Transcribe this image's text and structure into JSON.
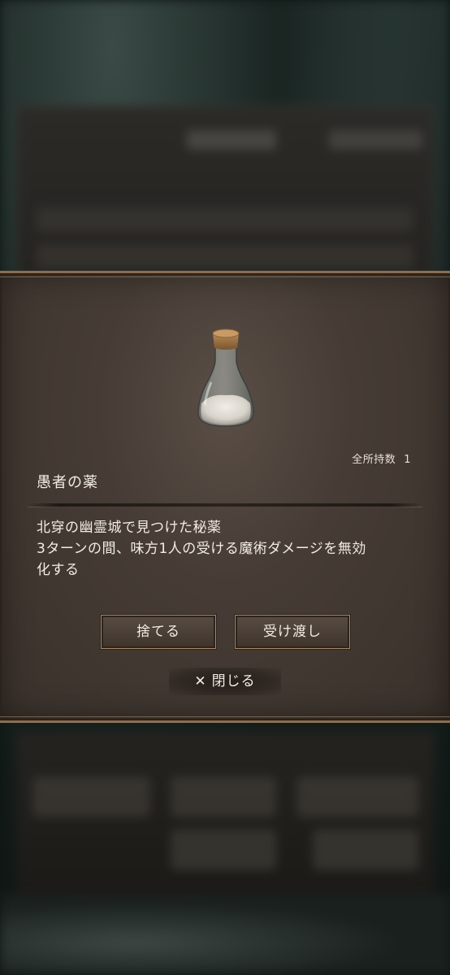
{
  "item": {
    "owned_label": "全所持数",
    "owned_count": "1",
    "name": "愚者の薬",
    "description_lines": [
      "北穿の幽霊城で見つけた秘薬",
      "3ターンの間、味方1人の受ける魔術ダメージを無効",
      "化する"
    ],
    "icon": "potion-bottle-icon"
  },
  "actions": {
    "discard_label": "捨てる",
    "transfer_label": "受け渡し",
    "close_label": "閉じる",
    "close_icon": "close-icon"
  },
  "colors": {
    "panel": "#463c35",
    "border_gold": "#8a6e52",
    "text": "#f2ece4"
  }
}
